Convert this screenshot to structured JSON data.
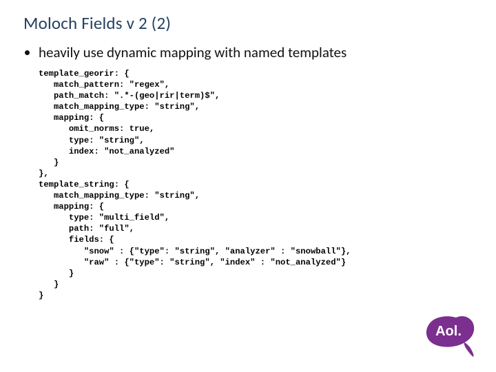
{
  "title": "Moloch Fields v 2 (2)",
  "bullet1": "heavily use dynamic mapping with named templates",
  "code": "template_georir: {\n   match_pattern: \"regex\",\n   path_match: \".*-(geo|rir|term)$\",\n   match_mapping_type: \"string\",\n   mapping: {\n      omit_norms: true,\n      type: \"string\",\n      index: \"not_analyzed\"\n   }\n},\ntemplate_string: {\n   match_mapping_type: \"string\",\n   mapping: {\n      type: \"multi_field\",\n      path: \"full\",\n      fields: {\n         \"snow\" : {\"type\": \"string\", \"analyzer\" : \"snowball\"},\n         \"raw\" : {\"type\": \"string\", \"index\" : \"not_analyzed\"}\n      }\n   }\n}",
  "logo_text": "Aol."
}
